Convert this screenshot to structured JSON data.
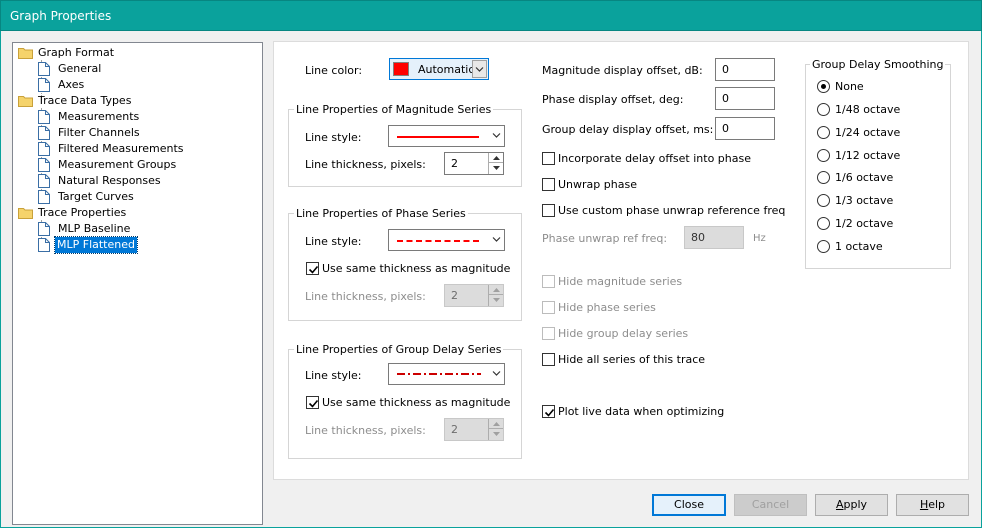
{
  "window": {
    "title": "Graph Properties"
  },
  "tree": {
    "items": [
      {
        "label": "Graph Format",
        "type": "folder"
      },
      {
        "label": "General",
        "type": "page"
      },
      {
        "label": "Axes",
        "type": "page"
      },
      {
        "label": "Trace Data Types",
        "type": "folder"
      },
      {
        "label": "Measurements",
        "type": "page"
      },
      {
        "label": "Filter Channels",
        "type": "page"
      },
      {
        "label": "Filtered Measurements",
        "type": "page"
      },
      {
        "label": "Measurement Groups",
        "type": "page"
      },
      {
        "label": "Natural Responses",
        "type": "page"
      },
      {
        "label": "Target Curves",
        "type": "page"
      },
      {
        "label": "Trace Properties",
        "type": "folder"
      },
      {
        "label": "MLP Baseline",
        "type": "page"
      },
      {
        "label": "MLP Flattened",
        "type": "page",
        "selected": true
      }
    ]
  },
  "line_color": {
    "label": "Line color:",
    "value": "Automatic",
    "swatch": "#ff0000"
  },
  "magnitude_series": {
    "title": "Line Properties of Magnitude Series",
    "style_label": "Line style:",
    "style": "solid",
    "thickness_label": "Line thickness, pixels:",
    "thickness": "2"
  },
  "phase_series": {
    "title": "Line Properties of Phase Series",
    "style_label": "Line style:",
    "style": "dashed",
    "same_thickness_label": "Use same thickness as magnitude",
    "same_thickness_checked": true,
    "thickness_label": "Line thickness, pixels:",
    "thickness": "2"
  },
  "group_delay_series": {
    "title": "Line Properties of Group Delay Series",
    "style_label": "Line style:",
    "style": "dash-dot",
    "same_thickness_label": "Use same thickness as magnitude",
    "same_thickness_checked": true,
    "thickness_label": "Line thickness, pixels:",
    "thickness": "2"
  },
  "offsets": {
    "magnitude_label": "Magnitude display offset, dB:",
    "magnitude": "0",
    "phase_label": "Phase display offset, deg:",
    "phase": "0",
    "group_delay_label": "Group delay display offset, ms:",
    "group_delay": "0"
  },
  "options": {
    "incorporate_delay": {
      "label": "Incorporate delay offset into phase",
      "checked": false
    },
    "unwrap_phase": {
      "label": "Unwrap phase",
      "checked": false
    },
    "custom_unwrap": {
      "label": "Use custom phase unwrap reference freq",
      "checked": false
    },
    "unwrap_ref_label": "Phase unwrap ref freq:",
    "unwrap_ref_value": "80",
    "unwrap_ref_unit": "Hz",
    "hide_magnitude": {
      "label": "Hide magnitude series",
      "checked": false,
      "enabled": false
    },
    "hide_phase": {
      "label": "Hide phase series",
      "checked": false,
      "enabled": false
    },
    "hide_group_delay": {
      "label": "Hide group delay series",
      "checked": false,
      "enabled": false
    },
    "hide_all": {
      "label": "Hide all series of this trace",
      "checked": false
    },
    "plot_live": {
      "label": "Plot live data when optimizing",
      "checked": true
    }
  },
  "smoothing": {
    "title": "Group Delay Smoothing",
    "options": [
      "None",
      "1/48 octave",
      "1/24 octave",
      "1/12 octave",
      "1/6 octave",
      "1/3 octave",
      "1/2 octave",
      "1 octave"
    ],
    "selected": "None"
  },
  "buttons": {
    "close": "Close",
    "cancel": "Cancel",
    "apply_prefix": "",
    "apply_key": "A",
    "apply_rest": "pply",
    "help_key": "H",
    "help_rest": "elp"
  },
  "colors": {
    "titlebar": "#0aa29c",
    "selection": "#0078d7",
    "series_red": "#ff0000",
    "dash_dot_red": "#cc0000"
  }
}
